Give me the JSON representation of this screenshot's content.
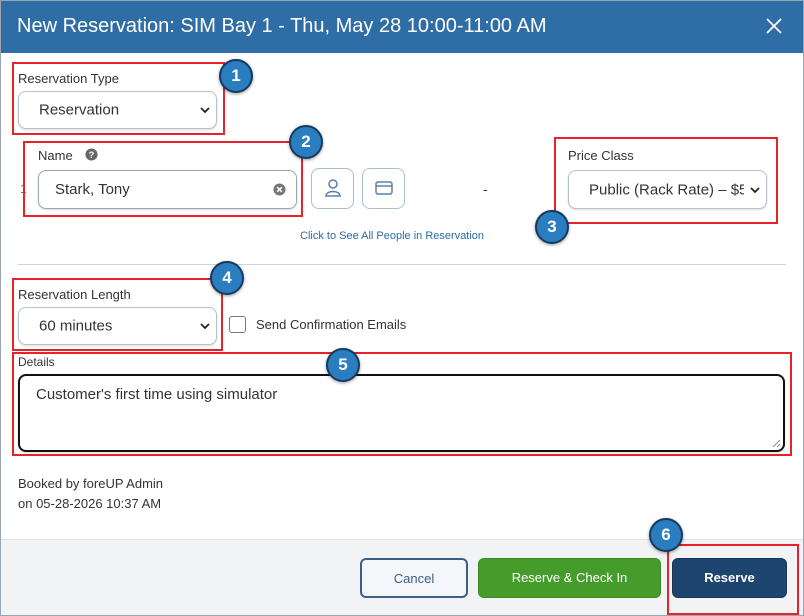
{
  "dialog": {
    "title": "New Reservation: SIM Bay 1 - Thu, May 28 10:00-11:00 AM",
    "close_icon": "close-icon"
  },
  "reservation_type": {
    "label": "Reservation Type",
    "value": "Reservation"
  },
  "name": {
    "row_number": "1",
    "label": "Name",
    "help_icon": "question-circle-icon",
    "value": "Stark, Tony",
    "clear_icon": "clear-icon"
  },
  "person_buttons": {
    "person_icon": "person-icon",
    "card_icon": "credit-card-icon"
  },
  "separator_dash": "-",
  "price_class": {
    "label": "Price Class",
    "value": "Public (Rack Rate) – $5"
  },
  "people_link": "Click to See All People in Reservation",
  "reservation_length": {
    "label": "Reservation Length",
    "value": "60 minutes"
  },
  "send_confirmation": {
    "label": "Send Confirmation Emails",
    "checked": false
  },
  "details": {
    "label": "Details",
    "value": "Customer's first time using simulator"
  },
  "booked_by": {
    "line1": "Booked by foreUP Admin",
    "line2": "on 05-28-2026 10:37 AM"
  },
  "buttons": {
    "cancel": "Cancel",
    "reserve_checkin": "Reserve & Check In",
    "reserve": "Reserve"
  },
  "callouts": [
    "1",
    "2",
    "3",
    "4",
    "5",
    "6"
  ],
  "colors": {
    "header": "#2f6da6",
    "highlight": "#e8212b",
    "badge": "#2a7ec0",
    "check_in": "#469c2b",
    "reserve": "#1e4470"
  }
}
